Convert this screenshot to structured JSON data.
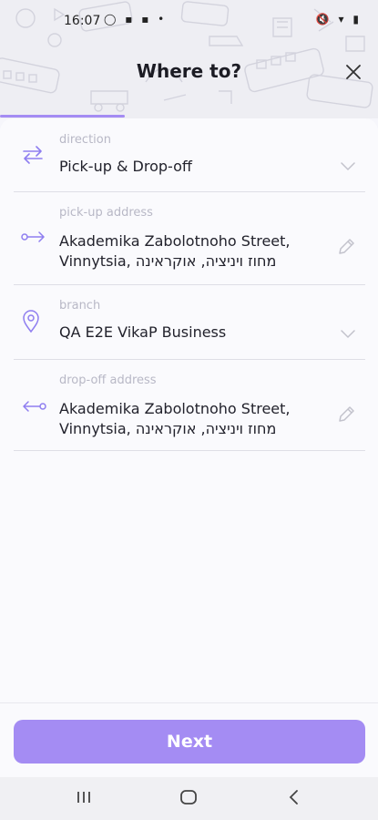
{
  "status_bar": {
    "time": "16:07",
    "left_icons": "◯ ▪ ▪ •",
    "right_icons": "🔇 ▾ ▮"
  },
  "header": {
    "title": "Where to?"
  },
  "progress": {
    "fraction": 0.33,
    "color": "#a48cf3"
  },
  "fields": {
    "direction": {
      "label": "direction",
      "value": "Pick-up & Drop-off"
    },
    "pickup": {
      "label": "pick-up address",
      "line1": "Akademika Zabolotnoho Street,",
      "line2": "Vinnytsia, מחוז ויניציה, אוקראינה"
    },
    "branch": {
      "label": "branch",
      "value": "QA E2E VikaP Business"
    },
    "dropoff": {
      "label": "drop-off address",
      "line1": "Akademika Zabolotnoho Street,",
      "line2": "Vinnytsia, מחוז ויניציה, אוקראינה"
    }
  },
  "actions": {
    "next_label": "Next"
  },
  "colors": {
    "accent": "#a48cf3",
    "icon": "#8f7ef0"
  }
}
